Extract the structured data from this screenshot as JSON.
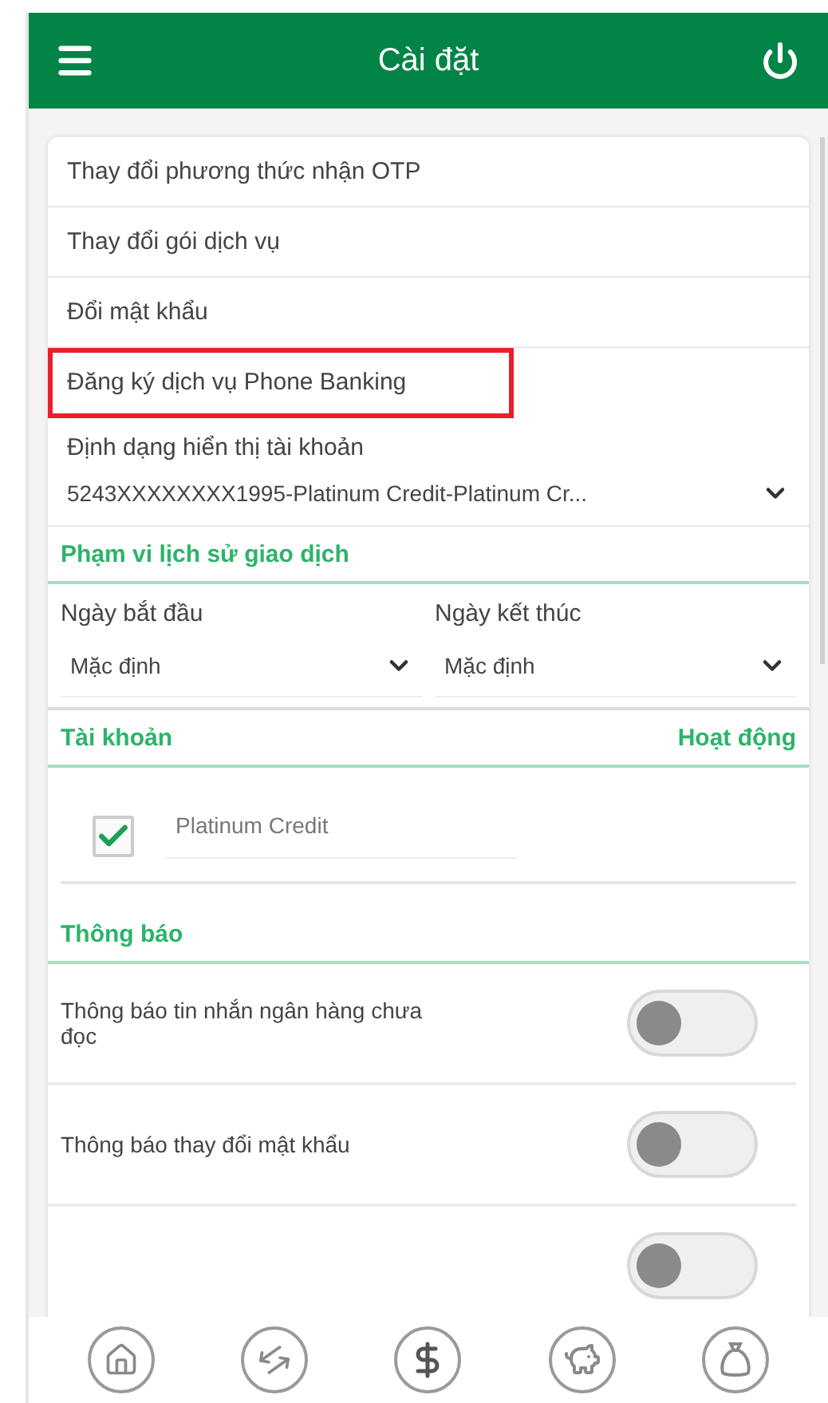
{
  "header": {
    "title": "Cài đặt"
  },
  "menu": [
    {
      "label": "Thay đổi phương thức nhận OTP",
      "highlighted": false
    },
    {
      "label": "Thay đổi gói dịch vụ",
      "highlighted": false
    },
    {
      "label": "Đổi mật khẩu",
      "highlighted": false
    },
    {
      "label": "Đăng ký dịch vụ Phone Banking",
      "highlighted": true
    }
  ],
  "account_format": {
    "label": "Định dạng hiển thị tài khoản",
    "value": "5243XXXXXXXX1995-Platinum Credit-Platinum Cr..."
  },
  "history_range": {
    "title": "Phạm vi lịch sử giao dịch",
    "fields": [
      {
        "label": "Ngày bắt đầu",
        "value": "Mặc định"
      },
      {
        "label": "Ngày kết thúc",
        "value": "Mặc định"
      }
    ]
  },
  "accounts": {
    "title": "Tài khoản",
    "column_2": "Hoạt động",
    "items": [
      {
        "name": "Platinum Credit",
        "checked": true
      }
    ]
  },
  "notifications": {
    "title": "Thông báo",
    "items": [
      {
        "label": "Thông báo tin nhắn ngân hàng chưa đọc",
        "on": false
      },
      {
        "label": "Thông báo thay đổi mật khẩu",
        "on": false
      },
      {
        "on": false
      }
    ]
  }
}
